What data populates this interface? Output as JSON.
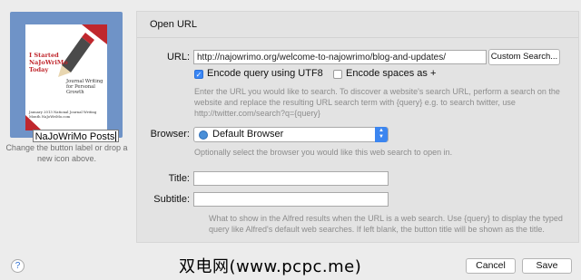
{
  "icon": {
    "name_field_value": "NaJoWriMo Posts",
    "image_text": {
      "title": "I Started NaJoWriMo Today",
      "subtitle": "Journal Writing for Personal Growth",
      "footer": "January 2013 National Journal Writing Month NaJoWriMo.com"
    },
    "help_text": "Change the button label or drop a new icon above."
  },
  "panel": {
    "title": "Open URL",
    "url_label": "URL:",
    "url_value": "http://najowrimo.org/welcome-to-najowrimo/blog-and-updates/",
    "custom_search_label": "Custom Search...",
    "encode_utf8_label": "Encode query using UTF8",
    "encode_utf8_checked": true,
    "encode_spaces_label": "Encode spaces as +",
    "encode_spaces_checked": false,
    "url_hint": "Enter the URL you would like to search. To discover a website's search URL, perform a search on the website and replace the resulting URL search term with {query} e.g. to search twitter, use http://twitter.com/search?q={query}",
    "browser_label": "Browser:",
    "browser_value": "Default Browser",
    "browser_hint": "Optionally select the browser you would like this web search to open in.",
    "title_label": "Title:",
    "title_value": "",
    "subtitle_label": "Subtitle:",
    "subtitle_value": "",
    "results_hint": "What to show in the Alfred results when the URL is a web search. Use {query} to display the typed query like Alfred's default web searches. If left blank, the button title will be shown as the title."
  },
  "footer": {
    "help_label": "?",
    "cancel_label": "Cancel",
    "save_label": "Save",
    "watermark": "双电网(www.pcpc.me)"
  },
  "colors": {
    "accent": "#3b87f5",
    "icon_well": "#6f93c7",
    "brand_red": "#c0272d"
  }
}
